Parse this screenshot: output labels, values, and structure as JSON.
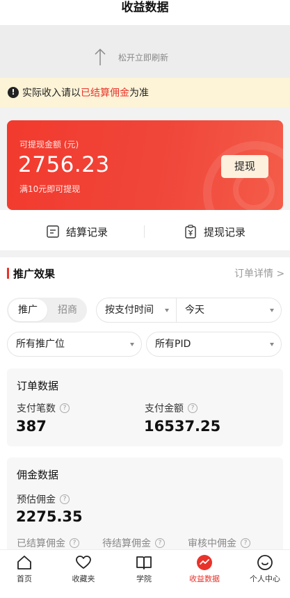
{
  "header": {
    "title": "收益数据"
  },
  "refresh": {
    "hint": "松开立即刷新"
  },
  "notice": {
    "prefix": "实际收入请以",
    "highlight": "已结算佣金",
    "suffix": "为准"
  },
  "balance": {
    "label": "可提现金额 (元)",
    "amount": "2756.23",
    "hint": "满10元即可提现",
    "withdraw_button": "提现"
  },
  "records": {
    "settlement": "结算记录",
    "withdrawal": "提现记录"
  },
  "promotion": {
    "title": "推广效果",
    "detail_link": "订单详情 >",
    "segment": {
      "selected": "推广",
      "other": "招商"
    },
    "filters": {
      "time_type": "按支付时间",
      "range": "今天",
      "position": "所有推广位",
      "pid": "所有PID"
    }
  },
  "orders": {
    "title": "订单数据",
    "pay_count_label": "支付笔数",
    "pay_count_value": "387",
    "pay_amount_label": "支付金额",
    "pay_amount_value": "16537.25"
  },
  "commission": {
    "title": "佣金数据",
    "estimated_label": "预估佣金",
    "estimated_value": "2275.35",
    "settled_label": "已结算佣金",
    "pending_label": "待结算佣金",
    "review_label": "审核中佣金"
  },
  "tabbar": {
    "items": [
      {
        "label": "首页",
        "icon": "home-icon"
      },
      {
        "label": "收藏夹",
        "icon": "heart-icon"
      },
      {
        "label": "学院",
        "icon": "book-icon"
      },
      {
        "label": "收益数据",
        "icon": "trend-icon"
      },
      {
        "label": "个人中心",
        "icon": "smile-icon"
      }
    ]
  },
  "colors": {
    "accent": "#e8332a",
    "notice_bg": "#fdf3d7",
    "card_start": "#f23a2e",
    "card_end": "#f45c49",
    "button_bg": "#fdf1de"
  }
}
